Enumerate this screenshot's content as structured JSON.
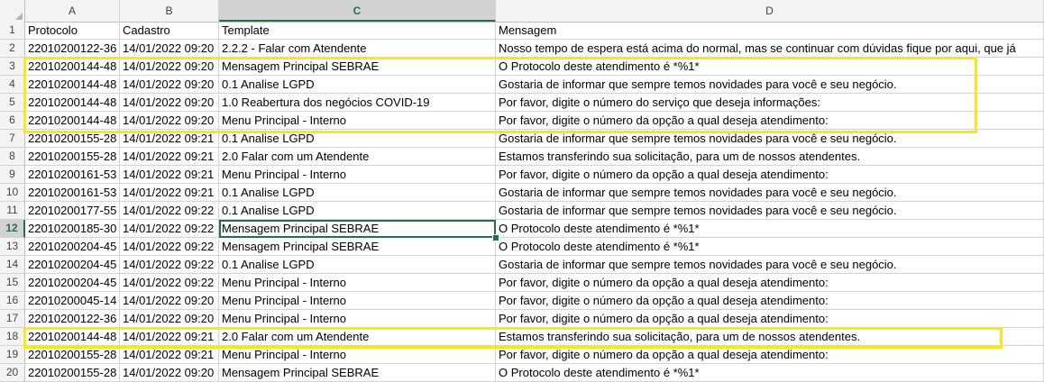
{
  "columns": [
    "A",
    "B",
    "C",
    "D"
  ],
  "selected_column": "C",
  "selected_row": 12,
  "highlight_color": "#f5e81c",
  "accent_color": "#217346",
  "header_row": {
    "row_number": "1",
    "cells": [
      "Protocolo",
      "Cadastro",
      "Template",
      "Mensagem"
    ]
  },
  "rows": [
    {
      "n": "2",
      "a": "22010200122-36",
      "b": "14/01/2022 09:20",
      "c": "2.2.2 - Falar com Atendente",
      "d": "Nosso tempo de espera está acima do normal, mas se continuar com dúvidas fique por aqui, que já"
    },
    {
      "n": "3",
      "a": "22010200144-48",
      "b": "14/01/2022 09:20",
      "c": "Mensagem Principal SEBRAE",
      "d": "O Protocolo deste atendimento é *%1*"
    },
    {
      "n": "4",
      "a": "22010200144-48",
      "b": "14/01/2022 09:20",
      "c": "0.1 Analise LGPD",
      "d": "Gostaria de informar que sempre temos novidades para você e seu negócio."
    },
    {
      "n": "5",
      "a": "22010200144-48",
      "b": "14/01/2022 09:20",
      "c": "1.0 Reabertura dos negócios COVID-19",
      "d": "Por favor, digite o número do serviço que deseja informações:"
    },
    {
      "n": "6",
      "a": "22010200144-48",
      "b": "14/01/2022 09:20",
      "c": "Menu Principal - Interno",
      "d": "Por favor, digite o número da opção a qual deseja atendimento:"
    },
    {
      "n": "7",
      "a": "22010200155-28",
      "b": "14/01/2022 09:21",
      "c": "0.1 Analise LGPD",
      "d": "Gostaria de informar que sempre temos novidades para você e seu negócio."
    },
    {
      "n": "8",
      "a": "22010200155-28",
      "b": "14/01/2022 09:21",
      "c": "2.0 Falar com um Atendente",
      "d": "Estamos transferindo sua solicitação, para um de nossos atendentes."
    },
    {
      "n": "9",
      "a": "22010200161-53",
      "b": "14/01/2022 09:21",
      "c": "Menu Principal - Interno",
      "d": "Por favor, digite o número da opção a qual deseja atendimento:"
    },
    {
      "n": "10",
      "a": "22010200161-53",
      "b": "14/01/2022 09:21",
      "c": "0.1 Analise LGPD",
      "d": "Gostaria de informar que sempre temos novidades para você e seu negócio."
    },
    {
      "n": "11",
      "a": "22010200177-55",
      "b": "14/01/2022 09:22",
      "c": "0.1 Analise LGPD",
      "d": "Gostaria de informar que sempre temos novidades para você e seu negócio."
    },
    {
      "n": "12",
      "a": "22010200185-30",
      "b": "14/01/2022 09:22",
      "c": "Mensagem Principal SEBRAE",
      "d": "O Protocolo deste atendimento é *%1*"
    },
    {
      "n": "13",
      "a": "22010200204-45",
      "b": "14/01/2022 09:22",
      "c": "Mensagem Principal SEBRAE",
      "d": "O Protocolo deste atendimento é *%1*"
    },
    {
      "n": "14",
      "a": "22010200204-45",
      "b": "14/01/2022 09:22",
      "c": "0.1 Analise LGPD",
      "d": "Gostaria de informar que sempre temos novidades para você e seu negócio."
    },
    {
      "n": "15",
      "a": "22010200204-45",
      "b": "14/01/2022 09:22",
      "c": "Menu Principal - Interno",
      "d": "Por favor, digite o número da opção a qual deseja atendimento:"
    },
    {
      "n": "16",
      "a": "22010200045-14",
      "b": "14/01/2022 09:20",
      "c": "Menu Principal - Interno",
      "d": "Por favor, digite o número da opção a qual deseja atendimento:"
    },
    {
      "n": "17",
      "a": "22010200122-36",
      "b": "14/01/2022 09:20",
      "c": "Menu Principal - Interno",
      "d": "Por favor, digite o número da opção a qual deseja atendimento:"
    },
    {
      "n": "18",
      "a": "22010200144-48",
      "b": "14/01/2022 09:21",
      "c": "2.0 Falar com um Atendente",
      "d": "Estamos transferindo sua solicitação, para um de nossos atendentes."
    },
    {
      "n": "19",
      "a": "22010200155-28",
      "b": "14/01/2022 09:21",
      "c": "Menu Principal - Interno",
      "d": "Por favor, digite o número da opção a qual deseja atendimento:"
    },
    {
      "n": "20",
      "a": "22010200155-28",
      "b": "14/01/2022 09:20",
      "c": "Mensagem Principal SEBRAE",
      "d": "O Protocolo deste atendimento é *%1*"
    }
  ]
}
